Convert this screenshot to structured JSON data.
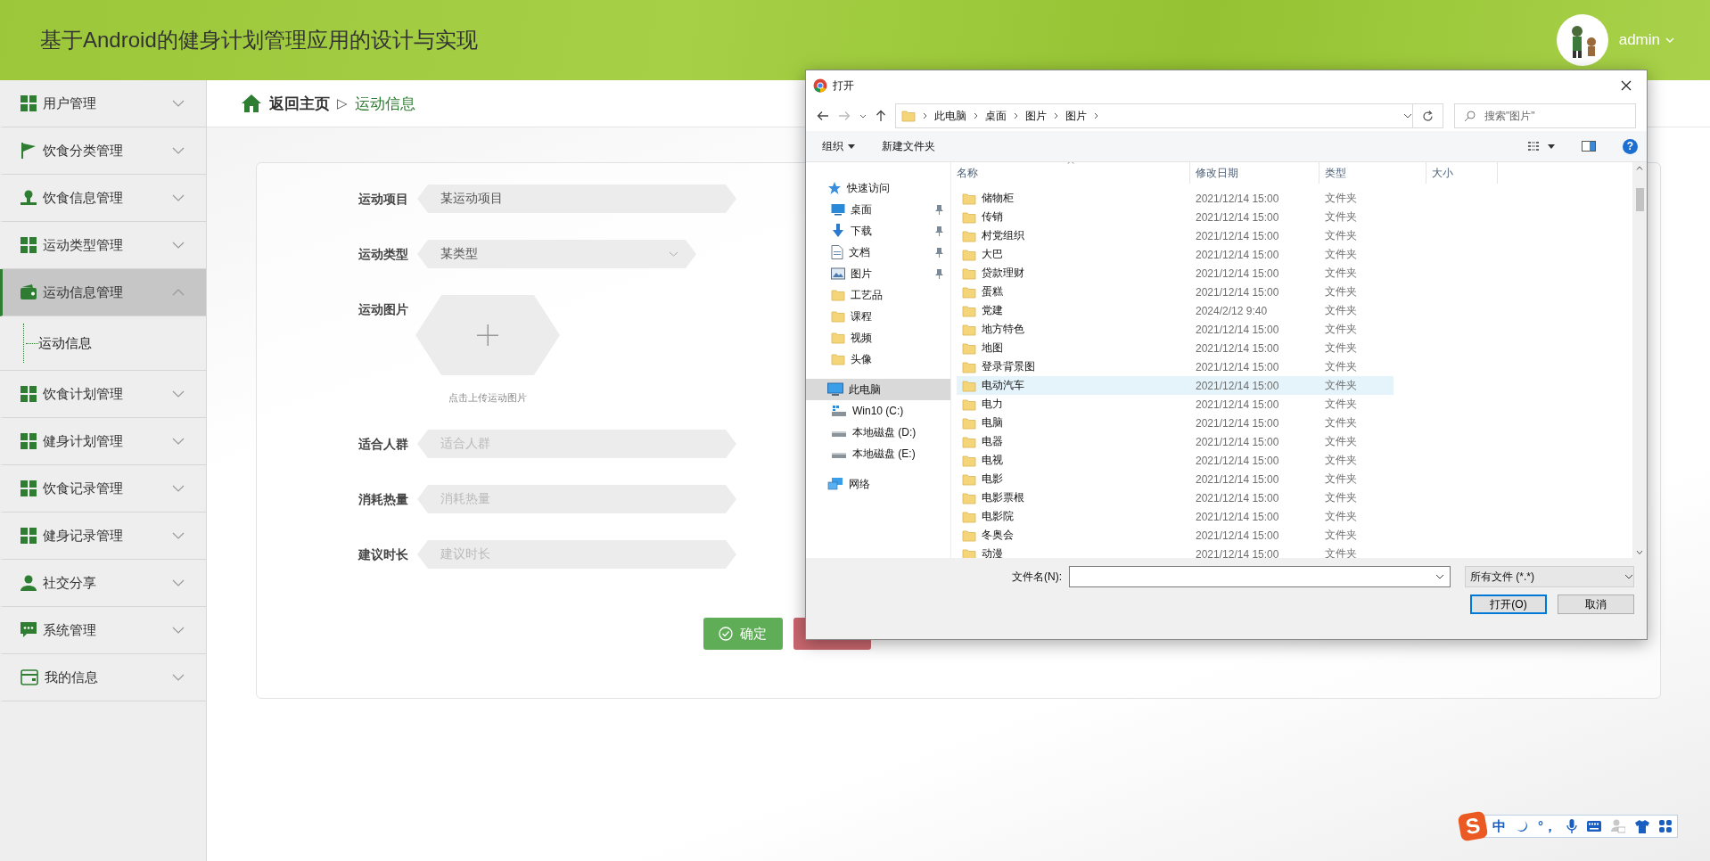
{
  "header": {
    "title": "基于Android的健身计划管理应用的设计与实现",
    "user": "admin"
  },
  "sidebar": {
    "items": [
      {
        "label": "用户管理",
        "kind": "grid",
        "expanded": false,
        "selected": false
      },
      {
        "label": "饮食分类管理",
        "kind": "flag",
        "expanded": false,
        "selected": false
      },
      {
        "label": "饮食信息管理",
        "kind": "user",
        "expanded": false,
        "selected": false
      },
      {
        "label": "运动类型管理",
        "kind": "grid",
        "expanded": false,
        "selected": false
      },
      {
        "label": "运动信息管理",
        "kind": "wallet",
        "expanded": true,
        "selected": true,
        "children": [
          {
            "label": "运动信息"
          }
        ]
      },
      {
        "label": "饮食计划管理",
        "kind": "grid",
        "expanded": false,
        "selected": false
      },
      {
        "label": "健身计划管理",
        "kind": "grid",
        "expanded": false,
        "selected": false
      },
      {
        "label": "饮食记录管理",
        "kind": "grid",
        "expanded": false,
        "selected": false
      },
      {
        "label": "健身记录管理",
        "kind": "grid",
        "expanded": false,
        "selected": false
      },
      {
        "label": "社交分享",
        "kind": "person",
        "expanded": false,
        "selected": false
      },
      {
        "label": "系统管理",
        "kind": "chat",
        "expanded": false,
        "selected": false
      },
      {
        "label": "我的信息",
        "kind": "card",
        "expanded": false,
        "selected": false
      }
    ]
  },
  "breadcrumb": {
    "home": "返回主页",
    "separator": "▷",
    "current": "运动信息"
  },
  "form": {
    "fields": [
      {
        "kind": "text",
        "label": "运动项目",
        "value": "某运动项目"
      },
      {
        "kind": "select",
        "label": "运动类型",
        "value": "某类型"
      },
      {
        "kind": "upload",
        "label": "运动图片",
        "hint": "点击上传运动图片"
      },
      {
        "kind": "text",
        "label": "适合人群",
        "placeholder": "适合人群"
      },
      {
        "kind": "text",
        "label": "消耗热量",
        "placeholder": "消耗热量"
      },
      {
        "kind": "text",
        "label": "建议时长",
        "placeholder": "建议时长"
      }
    ],
    "buttons": [
      {
        "kind": "confirm",
        "label": "确定"
      },
      {
        "kind": "cancel"
      }
    ]
  },
  "dialog": {
    "title": "打开",
    "path": [
      "此电脑",
      "桌面",
      "图片",
      "图片"
    ],
    "search_placeholder": "搜索\"图片\"",
    "toolbar": {
      "organize": "组织",
      "new_folder": "新建文件夹",
      "help": "?"
    },
    "nav": [
      {
        "kind": "quick",
        "label": "快速访问",
        "selected": false
      },
      {
        "kind": "desktop",
        "label": "桌面",
        "pinned": true,
        "selected": false
      },
      {
        "kind": "download",
        "label": "下载",
        "pinned": true,
        "selected": false
      },
      {
        "kind": "document",
        "label": "文档",
        "pinned": true,
        "selected": false
      },
      {
        "kind": "pictures",
        "label": "图片",
        "pinned": true,
        "selected": false
      },
      {
        "kind": "folder",
        "label": "工艺品",
        "pinned": false,
        "selected": false
      },
      {
        "kind": "folder",
        "label": "课程",
        "pinned": false,
        "selected": false
      },
      {
        "kind": "folder",
        "label": "视频",
        "pinned": false,
        "selected": false
      },
      {
        "kind": "folder",
        "label": "头像",
        "pinned": false,
        "selected": false
      },
      {
        "kind": "computer",
        "label": "此电脑",
        "selected": true
      },
      {
        "kind": "system-drive",
        "label": "Win10 (C:)",
        "selected": false
      },
      {
        "kind": "drive",
        "label": "本地磁盘 (D:)",
        "selected": false
      },
      {
        "kind": "drive",
        "label": "本地磁盘 (E:)",
        "selected": false
      },
      {
        "kind": "network",
        "label": "网络",
        "selected": false
      }
    ],
    "columns": [
      "名称",
      "修改日期",
      "类型",
      "大小"
    ],
    "files": [
      {
        "name": "储物柜",
        "date": "2021/12/14 15:00",
        "type": "文件夹",
        "selected": false
      },
      {
        "name": "传销",
        "date": "2021/12/14 15:00",
        "type": "文件夹",
        "selected": false
      },
      {
        "name": "村党组织",
        "date": "2021/12/14 15:00",
        "type": "文件夹",
        "selected": false
      },
      {
        "name": "大巴",
        "date": "2021/12/14 15:00",
        "type": "文件夹",
        "selected": false
      },
      {
        "name": "贷款理财",
        "date": "2021/12/14 15:00",
        "type": "文件夹",
        "selected": false
      },
      {
        "name": "蛋糕",
        "date": "2021/12/14 15:00",
        "type": "文件夹",
        "selected": false
      },
      {
        "name": "党建",
        "date": "2024/2/12 9:40",
        "type": "文件夹",
        "selected": false
      },
      {
        "name": "地方特色",
        "date": "2021/12/14 15:00",
        "type": "文件夹",
        "selected": false
      },
      {
        "name": "地图",
        "date": "2021/12/14 15:00",
        "type": "文件夹",
        "selected": false
      },
      {
        "name": "登录背景图",
        "date": "2021/12/14 15:00",
        "type": "文件夹",
        "selected": false
      },
      {
        "name": "电动汽车",
        "date": "2021/12/14 15:00",
        "type": "文件夹",
        "selected": true
      },
      {
        "name": "电力",
        "date": "2021/12/14 15:00",
        "type": "文件夹",
        "selected": false
      },
      {
        "name": "电脑",
        "date": "2021/12/14 15:00",
        "type": "文件夹",
        "selected": false
      },
      {
        "name": "电器",
        "date": "2021/12/14 15:00",
        "type": "文件夹",
        "selected": false
      },
      {
        "name": "电视",
        "date": "2021/12/14 15:00",
        "type": "文件夹",
        "selected": false
      },
      {
        "name": "电影",
        "date": "2021/12/14 15:00",
        "type": "文件夹",
        "selected": false
      },
      {
        "name": "电影票根",
        "date": "2021/12/14 15:00",
        "type": "文件夹",
        "selected": false
      },
      {
        "name": "电影院",
        "date": "2021/12/14 15:00",
        "type": "文件夹",
        "selected": false
      },
      {
        "name": "冬奥会",
        "date": "2021/12/14 15:00",
        "type": "文件夹",
        "selected": false
      },
      {
        "name": "动漫",
        "date": "2021/12/14 15:00",
        "type": "文件夹",
        "selected": false
      }
    ],
    "filename_label": "文件名(N):",
    "filetype": "所有文件 (*.*)",
    "buttons": [
      {
        "kind": "primary",
        "label": "打开(O)"
      },
      {
        "kind": "normal",
        "label": "取消"
      }
    ]
  },
  "ime": {
    "logo": "S",
    "mode": "中",
    "punctuation": "°，"
  }
}
